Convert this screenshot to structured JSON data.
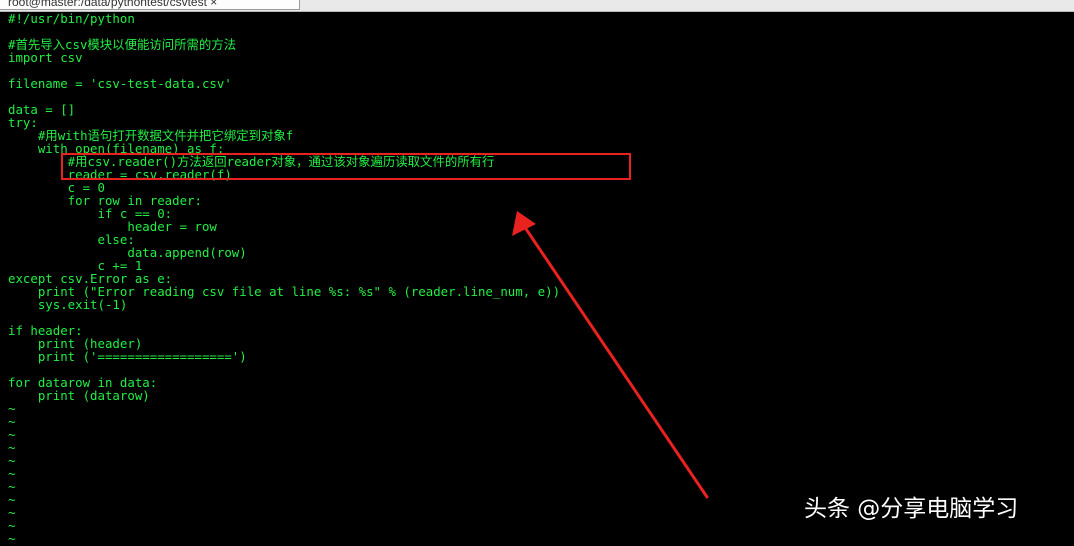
{
  "window": {
    "tab_title": "root@master:/data/pythontest/csvtest ×"
  },
  "editor": {
    "lines": [
      "#!/usr/bin/python",
      "",
      "#首先导入csv模块以便能访问所需的方法",
      "import csv",
      "",
      "filename = 'csv-test-data.csv'",
      "",
      "data = []",
      "try:",
      "    #用with语句打开数据文件并把它绑定到对象f",
      "    with open(filename) as f:",
      "        #用csv.reader()方法返回reader对象，通过该对象遍历读取文件的所有行",
      "        reader = csv.reader(f)",
      "        c = 0",
      "        for row in reader:",
      "            if c == 0:",
      "                header = row",
      "            else:",
      "                data.append(row)",
      "            c += 1",
      "except csv.Error as e:",
      "    print (\"Error reading csv file at line %s: %s\" % (reader.line_num, e))",
      "    sys.exit(-1)",
      "",
      "if header:",
      "    print (header)",
      "    print ('==================')",
      "",
      "for datarow in data:",
      "    print (datarow)"
    ],
    "empty_line_marker": "~",
    "empty_line_count": 11,
    "text_color": "#22ee44",
    "background_color": "#000000"
  },
  "annotation": {
    "box_color": "#e8231f",
    "arrow_color": "#e8231f"
  },
  "watermark": {
    "text": "头条 @分享电脑学习"
  }
}
